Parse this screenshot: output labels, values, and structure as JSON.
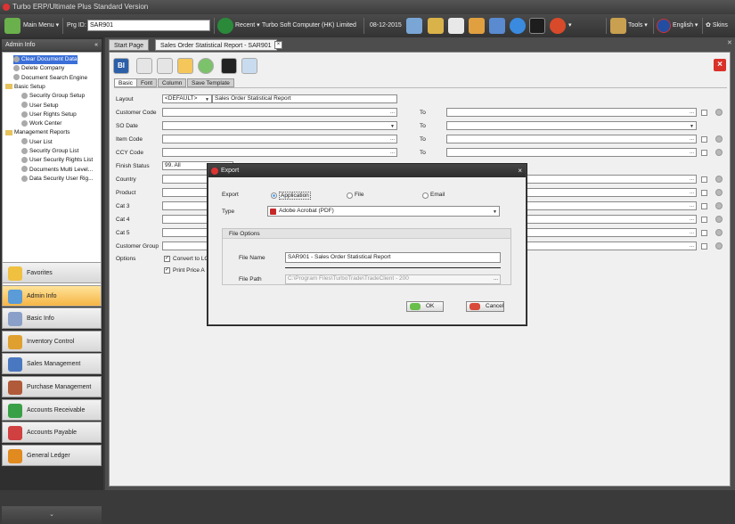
{
  "window": {
    "title": "Turbo ERP/Ultimate Plus Standard Version"
  },
  "toolbar": {
    "main_menu": "Main Menu",
    "prg_id_label": "Prg ID:",
    "prg_id_value": "SAR901",
    "recent": "Recent",
    "company": "Turbo Soft Computer (HK) Limited",
    "date": "08-12-2015",
    "tools": "Tools",
    "language": "English",
    "skins": "Skins"
  },
  "sidebar": {
    "header": "Admin Info",
    "collapse": "«",
    "tree": [
      {
        "label": "Clear Document Data",
        "selected": true,
        "indent": 1,
        "folder": false
      },
      {
        "label": "Delete Company",
        "indent": 1,
        "folder": false
      },
      {
        "label": "Document Search Engine",
        "indent": 1,
        "folder": false
      },
      {
        "label": "Basic Setup",
        "indent": 0,
        "folder": true
      },
      {
        "label": "Security Group Setup",
        "indent": 2,
        "folder": false
      },
      {
        "label": "User Setup",
        "indent": 2,
        "folder": false
      },
      {
        "label": "User Rights Setup",
        "indent": 2,
        "folder": false
      },
      {
        "label": "Work Center",
        "indent": 2,
        "folder": false
      },
      {
        "label": "Management Reports",
        "indent": 0,
        "folder": true
      },
      {
        "label": "User List",
        "indent": 2,
        "folder": false
      },
      {
        "label": "Security Group List",
        "indent": 2,
        "folder": false
      },
      {
        "label": "User Security Rights List",
        "indent": 2,
        "folder": false
      },
      {
        "label": "Documents Multi Level...",
        "indent": 2,
        "folder": false
      },
      {
        "label": "Data Security User Rig...",
        "indent": 2,
        "folder": false
      }
    ],
    "nav": [
      {
        "label": "Favorites",
        "color": "#f0c040"
      },
      {
        "label": "Admin Info",
        "color": "#5a9bd8",
        "active": true
      },
      {
        "label": "Basic Info",
        "color": "#8aa0c8"
      },
      {
        "label": "Inventory Control",
        "color": "#e0a030"
      },
      {
        "label": "Sales Management",
        "color": "#4a78c0"
      },
      {
        "label": "Purchase Management",
        "color": "#b05a3a"
      },
      {
        "label": "Accounts Receivable",
        "color": "#3aa048"
      },
      {
        "label": "Accounts Payable",
        "color": "#d04040"
      },
      {
        "label": "General Ledger",
        "color": "#e08a20"
      }
    ],
    "more": "⌄"
  },
  "tabs": {
    "start": "Start Page",
    "report": "Sales Order Statistical Report - SAR901",
    "close": "×"
  },
  "subtabs": [
    "Basic",
    "Font",
    "Column",
    "Save Template"
  ],
  "form": {
    "layout_label": "Layout",
    "layout_value": "<DEFAULT>",
    "layout_name": "Sales Order Statistical Report",
    "customer_code": "Customer Code",
    "so_date": "SO Date",
    "item_code": "Item Code",
    "ccy_code": "CCY Code",
    "finish_status": "Finish Status",
    "finish_status_value": "99. All",
    "country": "Country",
    "product": "Product",
    "cat3": "Cat 3",
    "cat4": "Cat 4",
    "cat5": "Cat 5",
    "customer_group": "Customer Group",
    "options": "Options",
    "convert_to": "Convert to LC",
    "print_price": "Print Price A",
    "to": "To",
    "dots": "...",
    "drop": "▼"
  },
  "dialog": {
    "title": "Export",
    "close": "×",
    "export_label": "Export",
    "opt_application": "Application",
    "opt_file": "File",
    "opt_email": "Email",
    "type_label": "Type",
    "type_value": "Adobe Acrobat (PDF)",
    "file_options": "File Options",
    "file_name_label": "File Name",
    "file_name_value": "SAR901 - Sales Order Statistical Report",
    "file_path_label": "File Path",
    "file_path_value": "C:\\Program Files\\TurboTrade\\TradeClient - 200",
    "ok": "OK",
    "cancel": "Cancel"
  }
}
